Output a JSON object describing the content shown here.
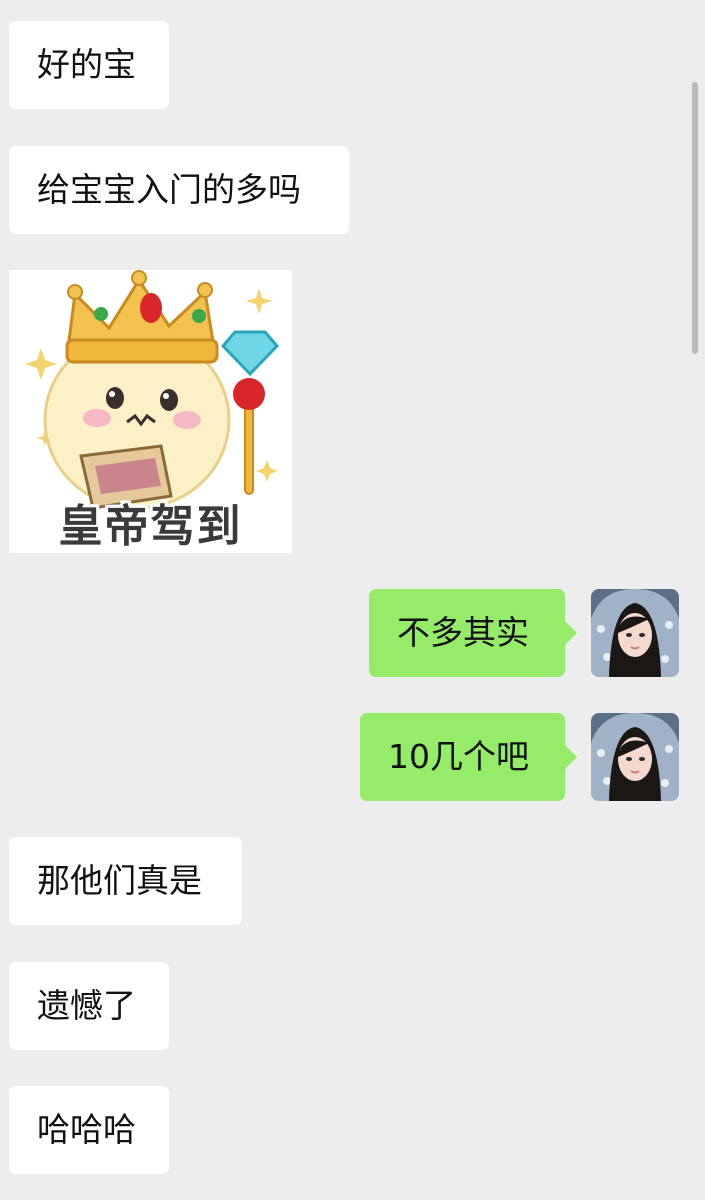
{
  "messages": [
    {
      "side": "in",
      "text": "好的宝"
    },
    {
      "side": "in",
      "text": "给宝宝入门的多吗"
    },
    {
      "side": "in",
      "type": "sticker",
      "caption": "皇帝驾到"
    },
    {
      "side": "out",
      "text": "不多其实",
      "avatar": "user-avatar-photo"
    },
    {
      "side": "out",
      "text": "10几个吧",
      "avatar": "user-avatar-photo"
    },
    {
      "side": "in",
      "text": "那他们真是"
    },
    {
      "side": "in",
      "text": "遗憾了"
    },
    {
      "side": "in",
      "text": "哈哈哈"
    }
  ],
  "colors": {
    "background": "#ededed",
    "incoming_bubble": "#ffffff",
    "outgoing_bubble": "#95ec69"
  }
}
